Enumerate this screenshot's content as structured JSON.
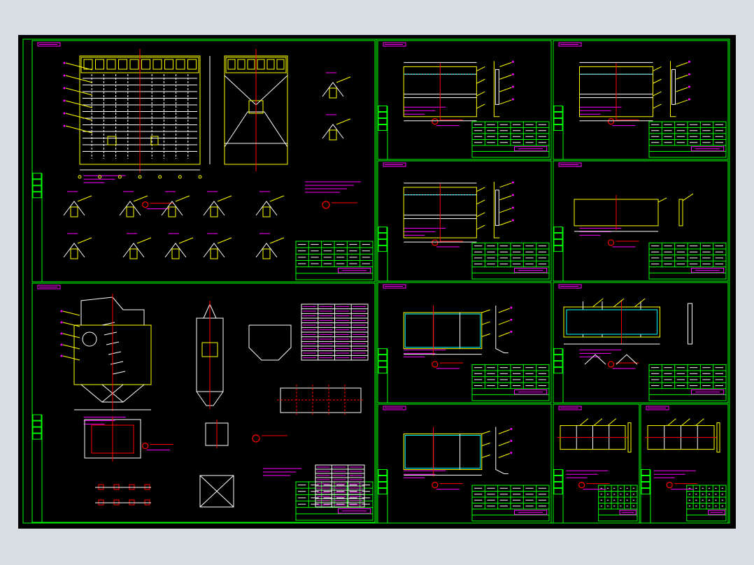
{
  "colors": {
    "background": "#d8dde3",
    "paper": "#000000",
    "frame": "#00ff00",
    "outline": "#ffff00",
    "structure": "#ffffff",
    "centerline": "#ff0000",
    "annotation": "#ff00ff",
    "dimension": "#00ffff"
  },
  "sheets": [
    {
      "id": "s1",
      "kind": "assembly-top"
    },
    {
      "id": "s2",
      "kind": "panel"
    },
    {
      "id": "s3",
      "kind": "panel"
    },
    {
      "id": "s4",
      "kind": "panel"
    },
    {
      "id": "s5",
      "kind": "panel-flat"
    },
    {
      "id": "s6",
      "kind": "assembly-bottom"
    },
    {
      "id": "s7",
      "kind": "frame-panel"
    },
    {
      "id": "s8",
      "kind": "wide-frame"
    },
    {
      "id": "s9",
      "kind": "frame-panel"
    },
    {
      "id": "s10",
      "kind": "small-frame"
    },
    {
      "id": "s11",
      "kind": "small-frame"
    }
  ]
}
